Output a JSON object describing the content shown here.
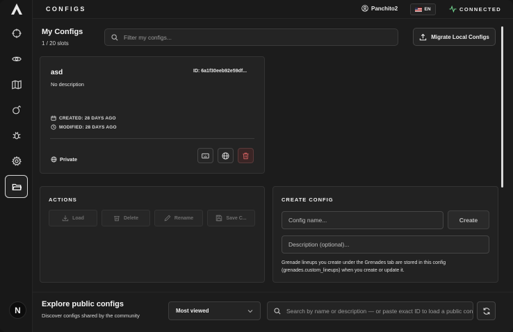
{
  "topbar": {
    "title": "CONFIGS",
    "username": "Panchito2",
    "language": "EN",
    "status": "CONNECTED"
  },
  "header": {
    "title": "My Configs",
    "slots": "1 / 20 slots",
    "search_placeholder": "Filter my configs...",
    "migrate_label": "Migrate Local Configs"
  },
  "config": {
    "name": "asd",
    "id": "ID: 6a1f30eeb92e59df...",
    "description": "No description",
    "created": "CREATED: 28 DAYS AGO",
    "modified": "MODIFIED: 28 DAYS AGO",
    "visibility": "Private"
  },
  "actions": {
    "title": "ACTIONS",
    "load": "Load",
    "delete": "Delete",
    "rename": "Rename",
    "save": "Save C..."
  },
  "create_config": {
    "title": "CREATE CONFIG",
    "name_placeholder": "Config name...",
    "create_label": "Create",
    "description_placeholder": "Description (optional)...",
    "note": "Grenade lineups you create under the Grenades tab are stored in this config (grenades.custom_lineups) when you create or update it."
  },
  "explore": {
    "title": "Explore public configs",
    "subtitle": "Discover configs shared by the community",
    "sort_selected": "Most viewed",
    "search_placeholder": "Search by name or description — or paste exact ID to load a public config"
  },
  "sidebar": {
    "avatar_letter": "N"
  },
  "colors": {
    "accent_connected": "#6fd08c",
    "danger": "#d06060",
    "background": "#1c1c1c"
  }
}
